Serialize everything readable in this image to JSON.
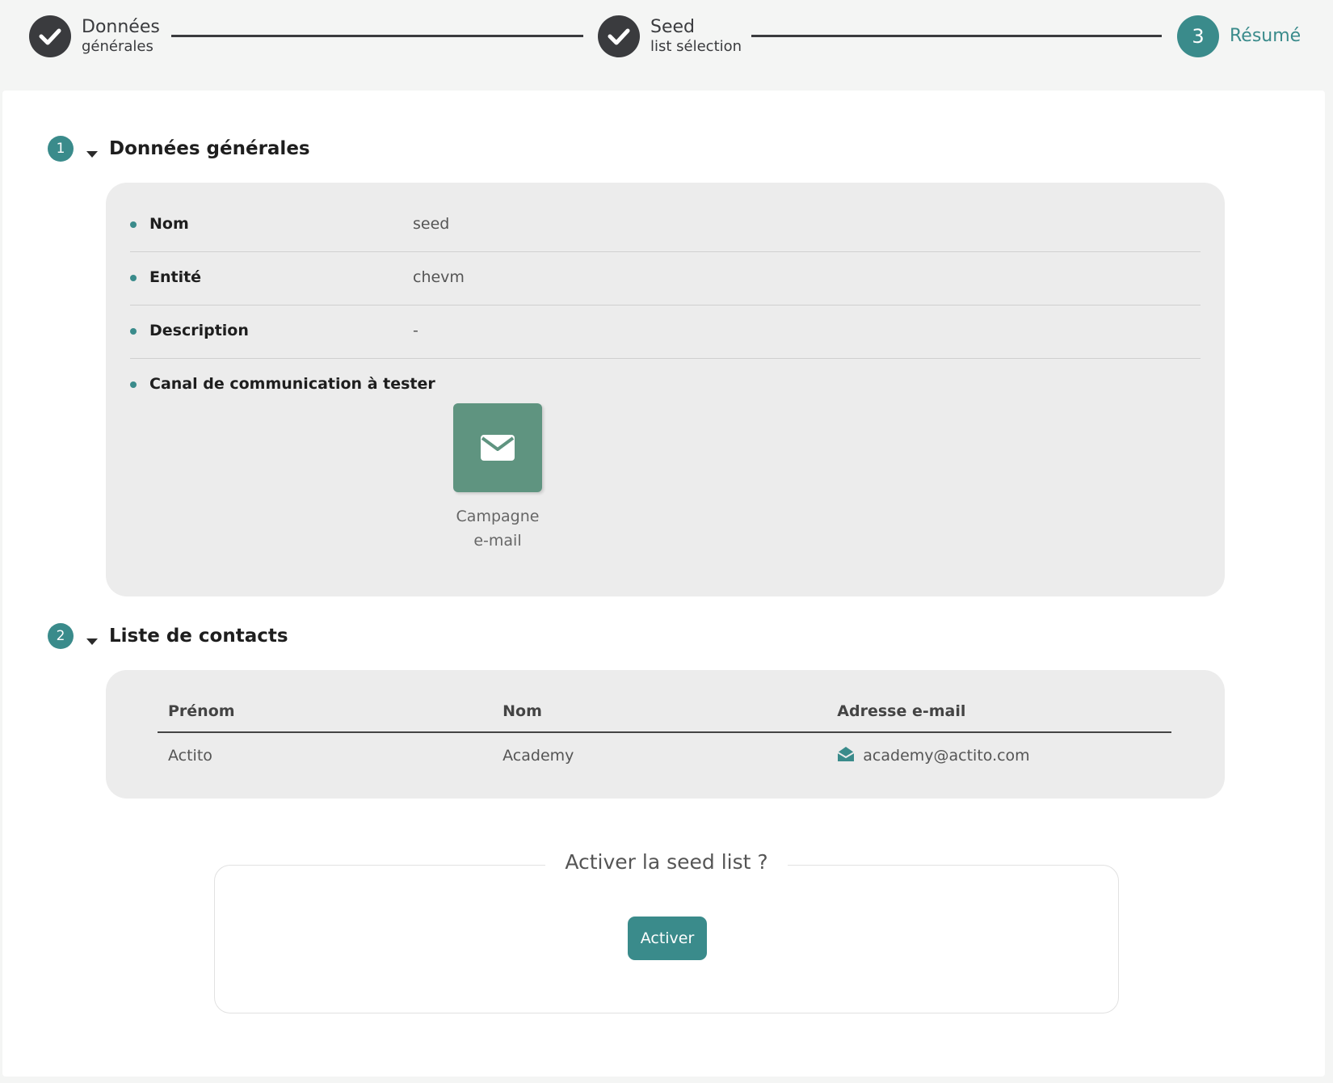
{
  "stepper": {
    "steps": [
      {
        "title": "Données",
        "subtitle": "générales",
        "status": "done"
      },
      {
        "title": "Seed",
        "subtitle": "list sélection",
        "status": "done"
      },
      {
        "number": "3",
        "title": "Résumé",
        "status": "active"
      }
    ]
  },
  "sections": {
    "general": {
      "number": "1",
      "title": "Données générales",
      "rows": [
        {
          "label": "Nom",
          "value": "seed"
        },
        {
          "label": "Entité",
          "value": "chevm"
        },
        {
          "label": "Description",
          "value": "-"
        },
        {
          "label": "Canal de communication à tester",
          "value": ""
        }
      ],
      "channel": {
        "icon": "envelope-icon",
        "label_line1": "Campagne",
        "label_line2": "e-mail"
      }
    },
    "contacts": {
      "number": "2",
      "title": "Liste de contacts",
      "columns": [
        "Prénom",
        "Nom",
        "Adresse e-mail"
      ],
      "rows": [
        {
          "first_name": "Actito",
          "last_name": "Academy",
          "email": "academy@actito.com"
        }
      ]
    }
  },
  "activation": {
    "legend": "Activer la seed list ?",
    "button_label": "Activer"
  },
  "colors": {
    "accent": "#3a8b8b",
    "done": "#3a3b3e",
    "channel_tile": "#5f9480",
    "panel_bg": "#ececec"
  }
}
